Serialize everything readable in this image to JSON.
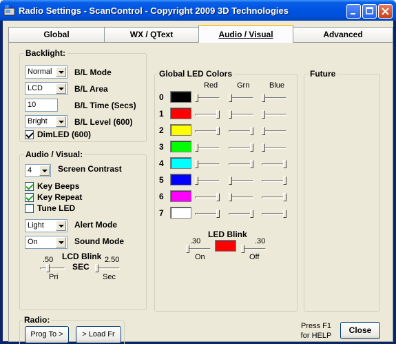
{
  "window": {
    "title": "Radio Settings - ScanControl - Copyright 2009 3D Technologies"
  },
  "tabs": [
    "Global",
    "WX / QText",
    "Audio / Visual",
    "Advanced"
  ],
  "backlight": {
    "title": "Backlight:",
    "mode": {
      "value": "Normal",
      "label": "B/L Mode"
    },
    "area": {
      "value": "LCD",
      "label": "B/L Area"
    },
    "time": {
      "value": "10",
      "label": "B/L Time (Secs)"
    },
    "level": {
      "value": "Bright",
      "label": "B/L Level (600)"
    },
    "dimled": {
      "label": "DimLED (600)",
      "checked": true
    }
  },
  "audio_visual": {
    "title": "Audio / Visual:",
    "contrast": {
      "value": "4",
      "label": "Screen Contrast"
    },
    "key_beeps": {
      "label": "Key Beeps",
      "checked": true
    },
    "key_repeat": {
      "label": "Key Repeat",
      "checked": true
    },
    "tune_led": {
      "label": "Tune LED",
      "checked": false
    },
    "alert_mode": {
      "value": "Light",
      "label": "Alert Mode"
    },
    "sound_mode": {
      "value": "On",
      "label": "Sound Mode"
    },
    "lcd_blink": {
      "title": "LCD Blink",
      "sec": "SEC",
      "pri_value": ".50",
      "pri_label": "Pri",
      "pri_level": 0.3,
      "sec_value": "2.50",
      "sec_label": "Sec",
      "sec_level": 0.0
    }
  },
  "led_colors": {
    "title": "Global LED Colors",
    "headers": [
      "Red",
      "Grn",
      "Blue"
    ],
    "rows": [
      {
        "index": "0",
        "color": "#000000",
        "levels": [
          0.0,
          0.0,
          0.0
        ]
      },
      {
        "index": "1",
        "color": "#FF0000",
        "levels": [
          1.0,
          0.0,
          0.0
        ]
      },
      {
        "index": "2",
        "color": "#FFFF00",
        "levels": [
          1.0,
          1.0,
          0.0
        ]
      },
      {
        "index": "3",
        "color": "#00FF00",
        "levels": [
          0.0,
          1.0,
          0.0
        ]
      },
      {
        "index": "4",
        "color": "#00FFFF",
        "levels": [
          0.0,
          1.0,
          1.0
        ]
      },
      {
        "index": "5",
        "color": "#0000FF",
        "levels": [
          0.0,
          0.0,
          1.0
        ]
      },
      {
        "index": "6",
        "color": "#FF00FF",
        "levels": [
          1.0,
          0.0,
          1.0
        ]
      },
      {
        "index": "7",
        "color": "#FFFFFF",
        "levels": [
          1.0,
          1.0,
          1.0
        ]
      }
    ],
    "blink": {
      "title": "LED Blink",
      "on_value": ".30",
      "on_label": "On",
      "on_level": 0.0,
      "off_value": ".30",
      "off_label": "Off",
      "off_level": 0.0,
      "color": "#FF0000"
    }
  },
  "future": {
    "title": "Future"
  },
  "radio": {
    "title": "Radio:",
    "prog_to": "Prog To >",
    "load_from": "> Load Fr"
  },
  "help": {
    "line1": "Press F1",
    "line2": "for HELP"
  },
  "close_label": "Close"
}
